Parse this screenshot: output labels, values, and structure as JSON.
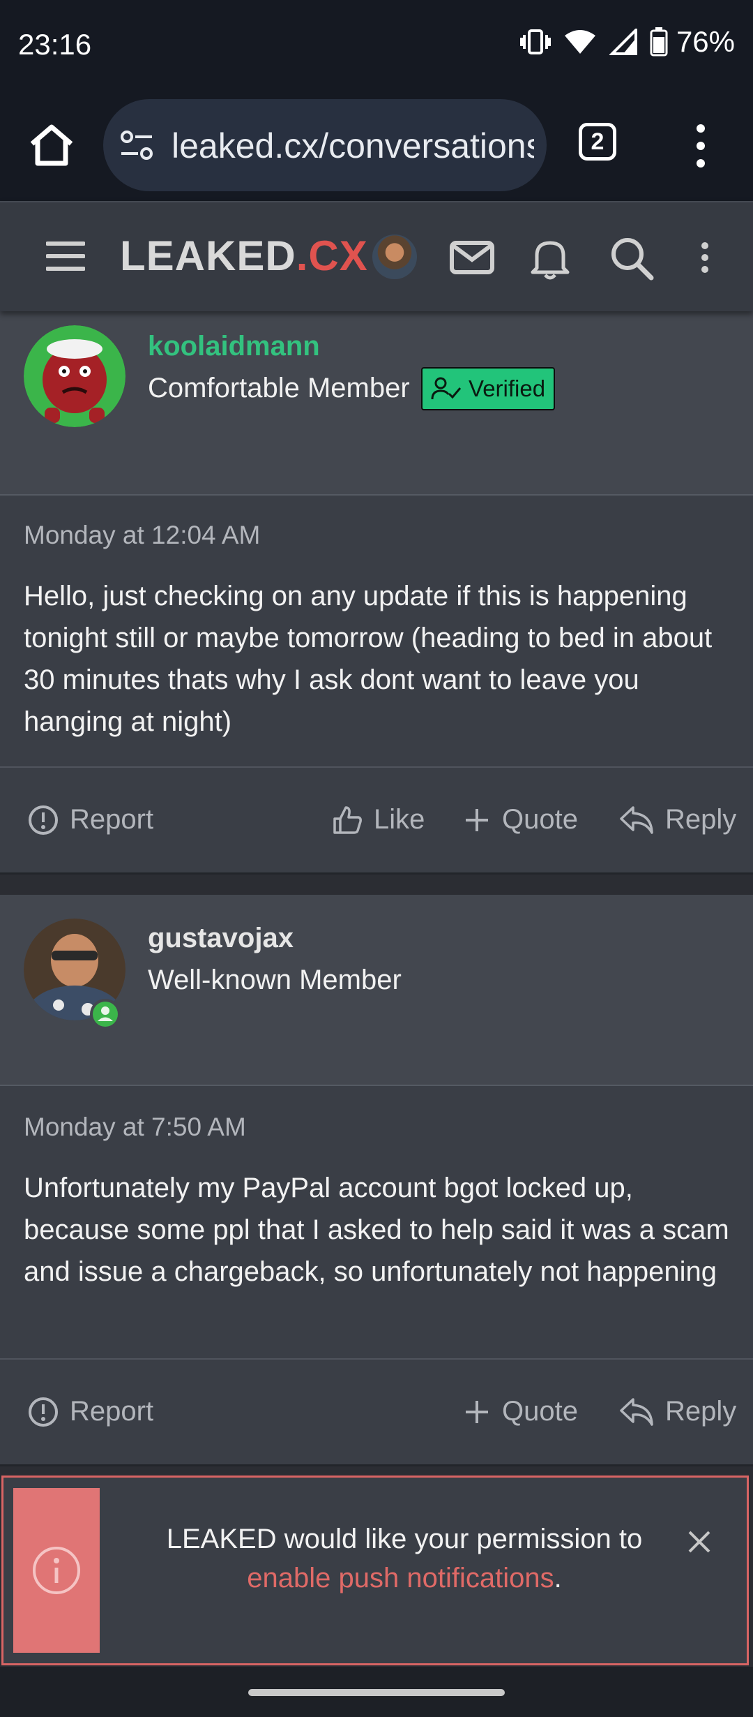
{
  "status_bar": {
    "time": "23:16",
    "battery": "76%"
  },
  "browser": {
    "url": "leaked.cx/conversations",
    "tab_count": "2"
  },
  "site": {
    "logo_main": "LEAKED",
    "logo_accent": ".CX"
  },
  "posts": [
    {
      "username": "koolaidmann",
      "username_color": "#33c27f",
      "user_title": "Comfortable Member",
      "badge": "Verified",
      "date": "Monday at 12:04 AM",
      "body": "Hello, just checking on any update if this is happening tonight still or maybe tomorrow (heading to bed in about 30 minutes thats why I ask dont want to leave you hanging at night)",
      "actions": {
        "report": "Report",
        "like": "Like",
        "quote": "Quote",
        "reply": "Reply"
      }
    },
    {
      "username": "gustavojax",
      "username_color": "#e6e6e6",
      "user_title": "Well-known Member",
      "date": "Monday at 7:50 AM",
      "body": "Unfortunately my PayPal account bgot locked up, because some ppl that I asked to help said it was a scam and issue a chargeback, so unfortunately not happening",
      "actions": {
        "report": "Report",
        "quote": "Quote",
        "reply": "Reply"
      }
    }
  ],
  "notification": {
    "text_before": "LEAKED would like your permission to",
    "link_text": "enable push notifications",
    "text_after": "."
  },
  "colors": {
    "accent": "#e0534f",
    "verified": "#22c47a",
    "online": "#3bb54a"
  }
}
